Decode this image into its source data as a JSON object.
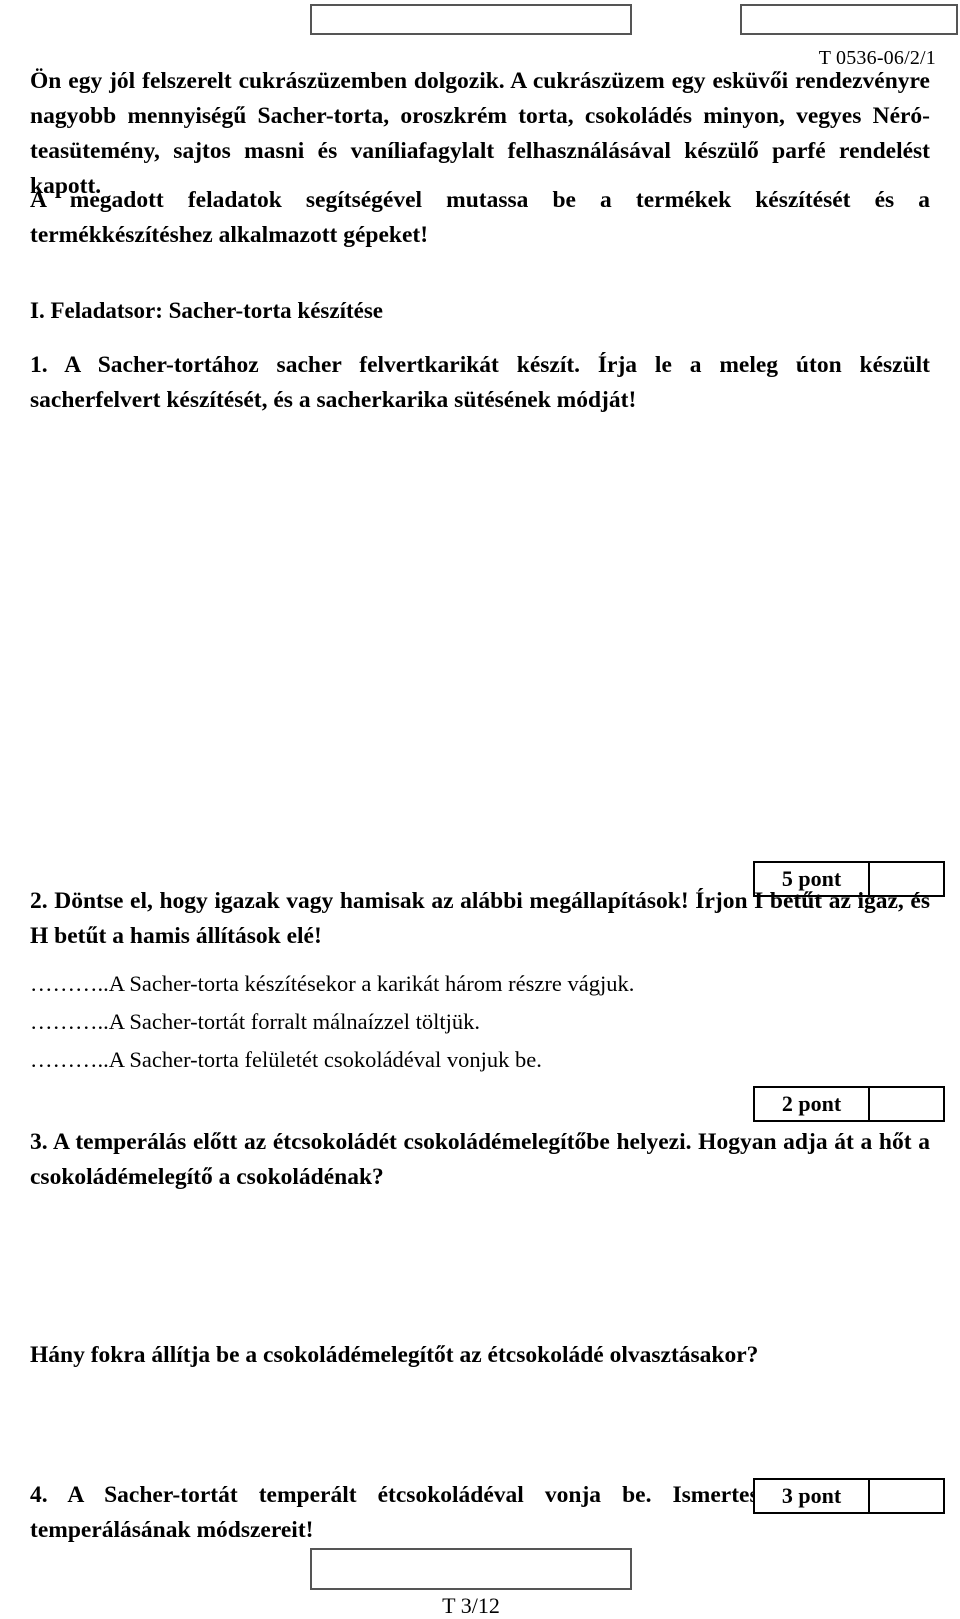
{
  "document": {
    "paper_code": "T 0536-06/2/1",
    "footer_code": "T 3/12"
  },
  "intro": {
    "text": "Ön egy jól felszerelt cukrászüzemben dolgozik. A cukrászüzem egy esküvői rendezvényre nagyobb mennyiségű Sacher-torta, oroszkrém torta, csokoládés minyon, vegyes Néró-teasütemény, sajtos masni és vaníliafagylalt felhasználásával készülő parfé rendelést kapott."
  },
  "instruction": {
    "text": "A megadott feladatok segítségével mutassa be a termékek készítését és a termékkészítéshez alkalmazott gépeket!"
  },
  "section": {
    "heading": "I. Feladatsor: Sacher-torta készítése"
  },
  "questions": [
    {
      "number": "1.",
      "text": "1. A Sacher-tortához sacher felvertkarikát készít. Írja le a meleg úton készült sacherfelvert készítését, és a sacherkarika sütésének módját!",
      "score_label": "5 pont"
    },
    {
      "number": "2.",
      "text": "2. Döntse el, hogy igazak vagy hamisak az alábbi megállapítások! Írjon I betűt az igaz, és H betűt a hamis állítások elé!",
      "statements": [
        "………..A Sacher-torta készítésekor a karikát három részre vágjuk.",
        "………..A Sacher-tortát forralt málnaízzel töltjük.",
        "………..A Sacher-torta felületét csokoládéval vonjuk be."
      ],
      "score_label": "2 pont"
    },
    {
      "number": "3.",
      "text": "3. A temperálás előtt az étcsokoládét csokoládémelegítőbe helyezi. Hogyan adja át a hőt a csokoládémelegítő a csokoládénak?",
      "followup": "Hány fokra állítja be a csokoládémelegítőt az étcsokoládé olvasztásakor?"
    },
    {
      "number": "4.",
      "text": "4. A Sacher-tortát temperált étcsokoládéval vonja be. Ismertesse a csokoládé temperálásának módszereit!",
      "score_label": "3 pont"
    }
  ]
}
